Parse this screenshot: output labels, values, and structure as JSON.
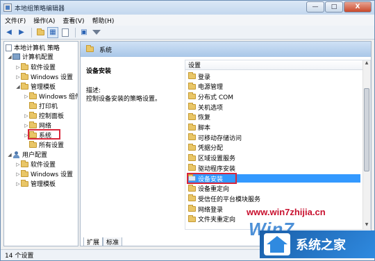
{
  "window": {
    "title": "本地组策略编辑器",
    "controls": [
      "—",
      "□",
      "X"
    ]
  },
  "menubar": [
    "文件(F)",
    "操作(A)",
    "查看(V)",
    "帮助(H)"
  ],
  "toolbar": {
    "icons": [
      "back-arrow-icon",
      "forward-arrow-icon",
      "folder-up-icon",
      "show-tree-icon",
      "document-icon",
      "help-panel-icon",
      "filter-icon"
    ]
  },
  "tree": {
    "root": "本地计算机 策略",
    "computer_config": "计算机配置",
    "computer_children": {
      "software": "软件设置",
      "windows": "Windows 设置",
      "admin_templates": "管理模板",
      "admin_children": {
        "windows_components": "Windows 组件",
        "printers": "打印机",
        "control_panel": "控制面板",
        "network": "网络",
        "system": "系统",
        "all_settings": "所有设置"
      }
    },
    "user_config": "用户配置",
    "user_children": {
      "software": "软件设置",
      "windows": "Windows 设置",
      "admin_templates": "管理模板"
    }
  },
  "right_panel": {
    "header": "系统",
    "description": {
      "title": "设备安装",
      "label": "描述:",
      "text": "控制设备安装的策略设置。"
    },
    "list_header": "设置",
    "items": [
      "登录",
      "电源管理",
      "分布式 COM",
      "关机选项",
      "恢复",
      "脚本",
      "可移动存储访问",
      "凭据分配",
      "区域设置服务",
      "驱动程序安装",
      "设备安装",
      "设备重定向",
      "受信任的平台模块服务",
      "网络登录",
      "文件夹重定向"
    ],
    "selected": "设备安装",
    "tabs": [
      "扩展",
      "标准"
    ]
  },
  "statusbar": {
    "text": "14 个设置"
  },
  "watermark": {
    "url": "www.win7zhijia.cn",
    "logo": "Win7",
    "brand": "系统之家"
  },
  "colors": {
    "selection": "#3399ff",
    "highlight_box": "#d9263a",
    "folder": "#e9c667"
  }
}
